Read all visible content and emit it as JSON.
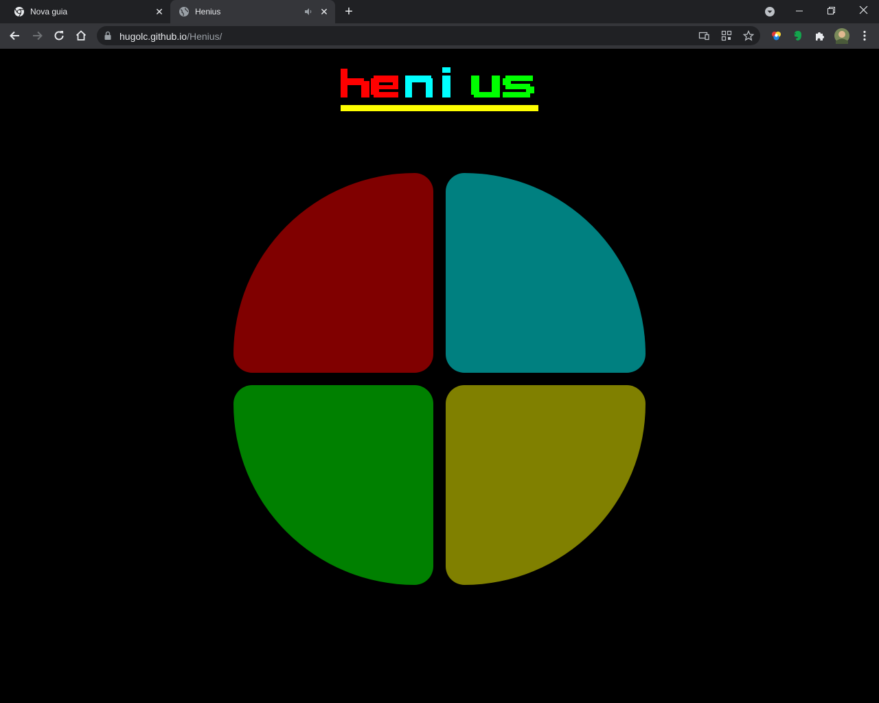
{
  "browser": {
    "tabs": [
      {
        "title": "Nova guia",
        "active": false
      },
      {
        "title": "Henius",
        "active": true
      }
    ],
    "url": {
      "host": "hugolc.github.io",
      "path": "/Henius/"
    }
  },
  "page": {
    "logo": {
      "letters": [
        {
          "char": "h",
          "color": "#ff0000"
        },
        {
          "char": "e",
          "color": "#ff0000"
        },
        {
          "char": "n",
          "color": "#00ffff"
        },
        {
          "char": "i",
          "color": "#00ffff"
        },
        {
          "char": "u",
          "color": "#00ff00"
        },
        {
          "char": "s",
          "color": "#00ff00"
        }
      ],
      "underline_color": "#ffff00"
    },
    "pads": [
      {
        "name": "red",
        "color": "#800000"
      },
      {
        "name": "teal",
        "color": "#008080"
      },
      {
        "name": "green",
        "color": "#008000"
      },
      {
        "name": "olive",
        "color": "#808000"
      }
    ]
  }
}
